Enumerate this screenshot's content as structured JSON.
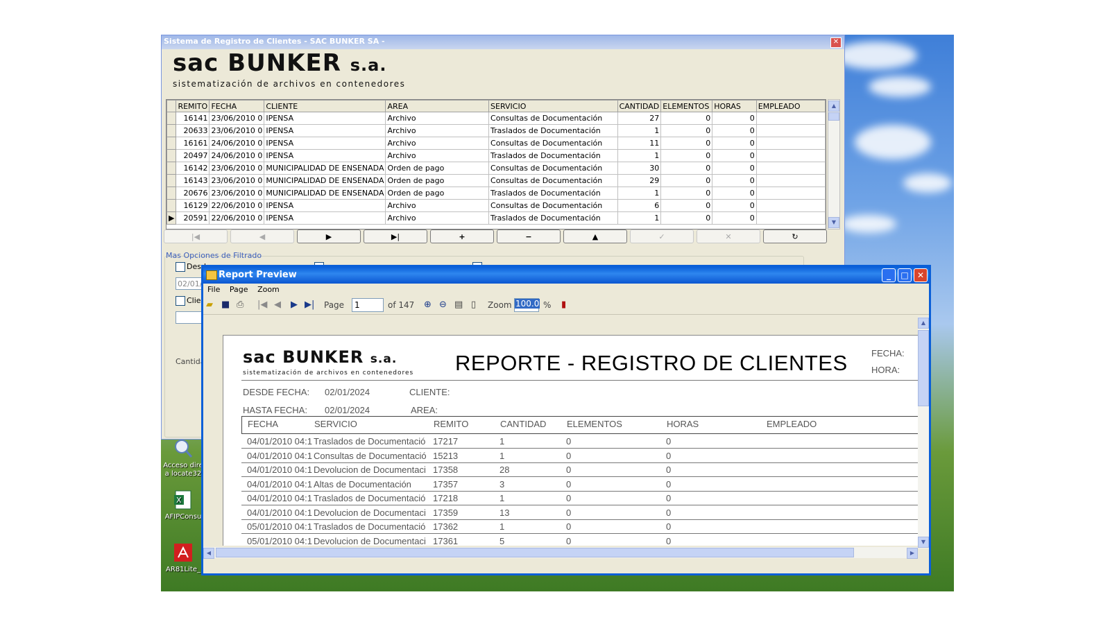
{
  "main_window": {
    "title": "Sistema de Registro de Clientes - SAC BUNKER SA -",
    "logo_main": "sac BUNKER",
    "logo_suffix": "s.a.",
    "logo_sub": "sistematización de archivos en contenedores",
    "grid": {
      "columns": [
        "REMITO",
        "FECHA",
        "CLIENTE",
        "AREA",
        "SERVICIO",
        "CANTIDAD",
        "ELEMENTOS",
        "HORAS",
        "EMPLEADO"
      ],
      "rows": [
        [
          "16141",
          "23/06/2010 0",
          "IPENSA",
          "Archivo",
          "Consultas de Documentación",
          "27",
          "0",
          "0",
          ""
        ],
        [
          "20633",
          "23/06/2010 0",
          "IPENSA",
          "Archivo",
          "Traslados de Documentación",
          "1",
          "0",
          "0",
          ""
        ],
        [
          "16161",
          "24/06/2010 0",
          "IPENSA",
          "Archivo",
          "Consultas de Documentación",
          "11",
          "0",
          "0",
          ""
        ],
        [
          "20497",
          "24/06/2010 0",
          "IPENSA",
          "Archivo",
          "Traslados de Documentación",
          "1",
          "0",
          "0",
          ""
        ],
        [
          "16142",
          "23/06/2010 0",
          "MUNICIPALIDAD DE ENSENADA",
          "Orden de pago",
          "Consultas de Documentación",
          "30",
          "0",
          "0",
          ""
        ],
        [
          "16143",
          "23/06/2010 0",
          "MUNICIPALIDAD DE ENSENADA",
          "Orden de pago",
          "Consultas de Documentación",
          "29",
          "0",
          "0",
          ""
        ],
        [
          "20676",
          "23/06/2010 0",
          "MUNICIPALIDAD DE ENSENADA",
          "Orden de pago",
          "Traslados de Documentación",
          "1",
          "0",
          "0",
          ""
        ],
        [
          "16129",
          "22/06/2010 0",
          "IPENSA",
          "Archivo",
          "Consultas de Documentación",
          "6",
          "0",
          "0",
          ""
        ],
        [
          "20591",
          "22/06/2010 0",
          "IPENSA",
          "Archivo",
          "Traslados de Documentación",
          "1",
          "0",
          "0",
          ""
        ]
      ],
      "current_row_indicator": "▶"
    },
    "nav_buttons": [
      "|◀",
      "◀",
      "▶",
      "▶|",
      "+",
      "−",
      "▲",
      "✓",
      "✕",
      "↻"
    ],
    "filter_title": "Mas Opciones de Filtrado",
    "filter": {
      "desde_label": "Desde",
      "desde_value": "02/01/",
      "cliente_label": "Clie",
      "cantidad_label": "Cantida"
    }
  },
  "desktop_icons": [
    {
      "name": "Acceso dire a locate32",
      "icon": "search-icon"
    },
    {
      "name": "AFIPConsu",
      "icon": "excel-icon"
    },
    {
      "name": "AR81Lite_",
      "icon": "pdf-icon"
    }
  ],
  "report_window": {
    "title": "Report Preview",
    "menu": [
      "File",
      "Page",
      "Zoom"
    ],
    "toolbar": {
      "page_label": "Page",
      "page_value": "1",
      "page_of": "of 147",
      "zoom_label": "Zoom",
      "zoom_value": "100.0",
      "zoom_unit": "%"
    },
    "report": {
      "logo_main": "sac BUNKER",
      "logo_suffix": "s.a.",
      "logo_sub": "sistematización de archivos en contenedores",
      "title": "REPORTE - REGISTRO DE CLIENTES",
      "fecha_label": "FECHA:",
      "hora_label": "HORA:",
      "desde_label": "DESDE FECHA:",
      "desde_value": "02/01/2024",
      "hasta_label": "HASTA FECHA:",
      "hasta_value": "02/01/2024",
      "cliente_label": "CLIENTE:",
      "area_label": "AREA:",
      "columns": [
        "FECHA",
        "SERVICIO",
        "REMITO",
        "CANTIDAD",
        "ELEMENTOS",
        "HORAS",
        "EMPLEADO"
      ],
      "rows": [
        [
          "04/01/2010 04:1",
          "Traslados de Documentació",
          "17217",
          "1",
          "0",
          "0",
          ""
        ],
        [
          "04/01/2010 04:1",
          "Consultas de Documentació",
          "15213",
          "1",
          "0",
          "0",
          ""
        ],
        [
          "04/01/2010 04:1",
          "Devolucion de Documentaci",
          "17358",
          "28",
          "0",
          "0",
          ""
        ],
        [
          "04/01/2010 04:1",
          "Altas de Documentación",
          "17357",
          "3",
          "0",
          "0",
          ""
        ],
        [
          "04/01/2010 04:1",
          "Traslados de Documentació",
          "17218",
          "1",
          "0",
          "0",
          ""
        ],
        [
          "04/01/2010 04:1",
          "Devolucion de Documentaci",
          "17359",
          "13",
          "0",
          "0",
          ""
        ],
        [
          "05/01/2010 04:1",
          "Traslados de Documentació",
          "17362",
          "1",
          "0",
          "0",
          ""
        ],
        [
          "05/01/2010 04:1",
          "Devolucion de Documentaci",
          "17361",
          "5",
          "0",
          "0",
          ""
        ]
      ]
    }
  }
}
